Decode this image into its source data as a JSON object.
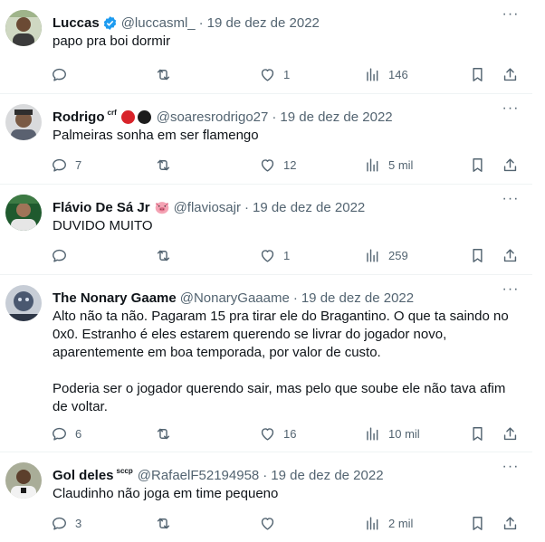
{
  "tweets": [
    {
      "name": "Luccas",
      "handle": "@luccasml_",
      "separator": "·",
      "date": "19 de dez de 2022",
      "text": [
        "papo pra boi dormir"
      ],
      "replies": "",
      "retweets": "",
      "likes": "1",
      "views": "146",
      "avatar_color": "#4a6b3a"
    },
    {
      "name": "Rodrigo",
      "badge": "crf",
      "handle": "@soaresrodrigo27",
      "separator": "·",
      "date": "19 de dez de 2022",
      "text": [
        "Palmeiras sonha em ser flamengo"
      ],
      "replies": "7",
      "retweets": "",
      "likes": "12",
      "views": "5 mil",
      "avatar_color": "#7d7f84",
      "dot_colors": [
        "#d8232a",
        "#1c1c1c"
      ]
    },
    {
      "name": "Flávio De Sá Jr",
      "handle": "@flaviosajr",
      "separator": "·",
      "date": "19 de dez de 2022",
      "text": [
        "DUVIDO MUITO"
      ],
      "replies": "",
      "retweets": "",
      "likes": "1",
      "views": "259",
      "avatar_color": "#2f6b3a"
    },
    {
      "name": "The Nonary Gaame",
      "handle": "@NonaryGaaame",
      "separator": "·",
      "date": "19 de dez de 2022",
      "text": [
        "Alto não ta não. Pagaram 15 pra tirar ele do Bragantino. O que ta saindo no 0x0. Estranho é eles estarem querendo se livrar do jogador novo, aparentemente em boa temporada, por valor de custo.",
        "Poderia ser o jogador querendo sair, mas pelo que soube ele não tava afim de voltar."
      ],
      "replies": "6",
      "retweets": "",
      "likes": "16",
      "views": "10 mil",
      "avatar_color": "#3b4a5c"
    },
    {
      "name": "Gol deles",
      "badge": "sccp",
      "handle": "@RafaelF52194958",
      "separator": "·",
      "date": "19 de dez de 2022",
      "text": [
        "Claudinho não joga em time pequeno"
      ],
      "replies": "3",
      "retweets": "",
      "likes": "",
      "views": "2 mil",
      "avatar_color": "#8a8f7a"
    }
  ],
  "colors": {
    "text": "#0f1419",
    "secondary": "#536471",
    "border": "#eff3f4",
    "verified": "#1d9bf0"
  },
  "icons": [
    "reply-icon",
    "retweet-icon",
    "like-icon",
    "views-icon",
    "bookmark-icon",
    "share-icon",
    "more-icon",
    "verified-badge-icon",
    "pig-emoji-icon"
  ]
}
